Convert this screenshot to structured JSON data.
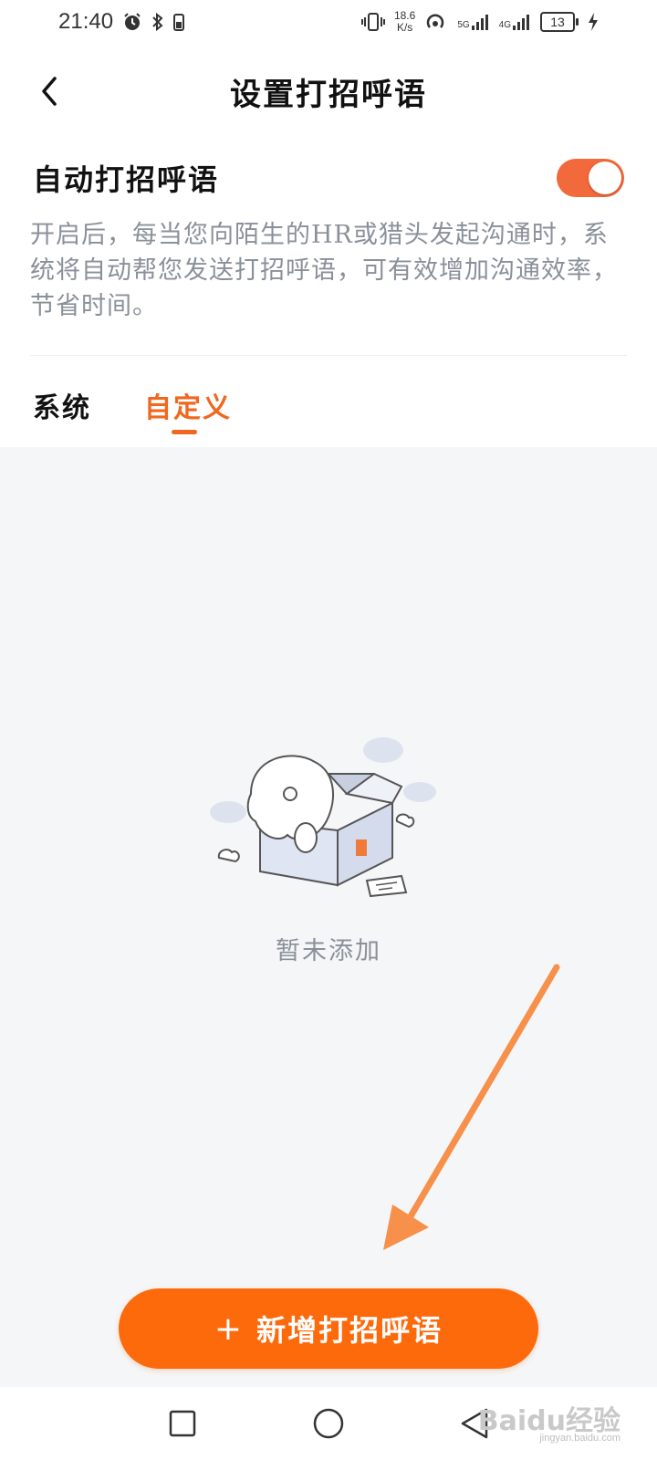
{
  "status_bar": {
    "time": "21:40",
    "speed_value": "18.6",
    "speed_unit": "K/s",
    "net1": "5G",
    "net2": "4G",
    "battery": "13",
    "icons": [
      "alarm-icon",
      "bluetooth-icon",
      "vibrate-icon",
      "hotspot-icon",
      "signal-icon",
      "charging-icon"
    ]
  },
  "header": {
    "title": "设置打招呼语"
  },
  "auto_greeting": {
    "label": "自动打招呼语",
    "enabled": true,
    "description": "开启后，每当您向陌生的HR或猎头发起沟通时，系统将自动帮您发送打招呼语，可有效增加沟通效率，节省时间。"
  },
  "tabs": [
    {
      "label": "系统",
      "active": false
    },
    {
      "label": "自定义",
      "active": true
    }
  ],
  "empty_state": {
    "text": "暂未添加"
  },
  "add_button": {
    "icon": "+",
    "label": "新增打招呼语"
  },
  "watermark": {
    "text": "Baidu经验",
    "sub": "jingyan.baidu.com"
  },
  "colors": {
    "accent": "#fd6a0c",
    "toggle": "#f2693b",
    "tab_active": "#f0681f",
    "content_bg": "#f5f6f8"
  }
}
